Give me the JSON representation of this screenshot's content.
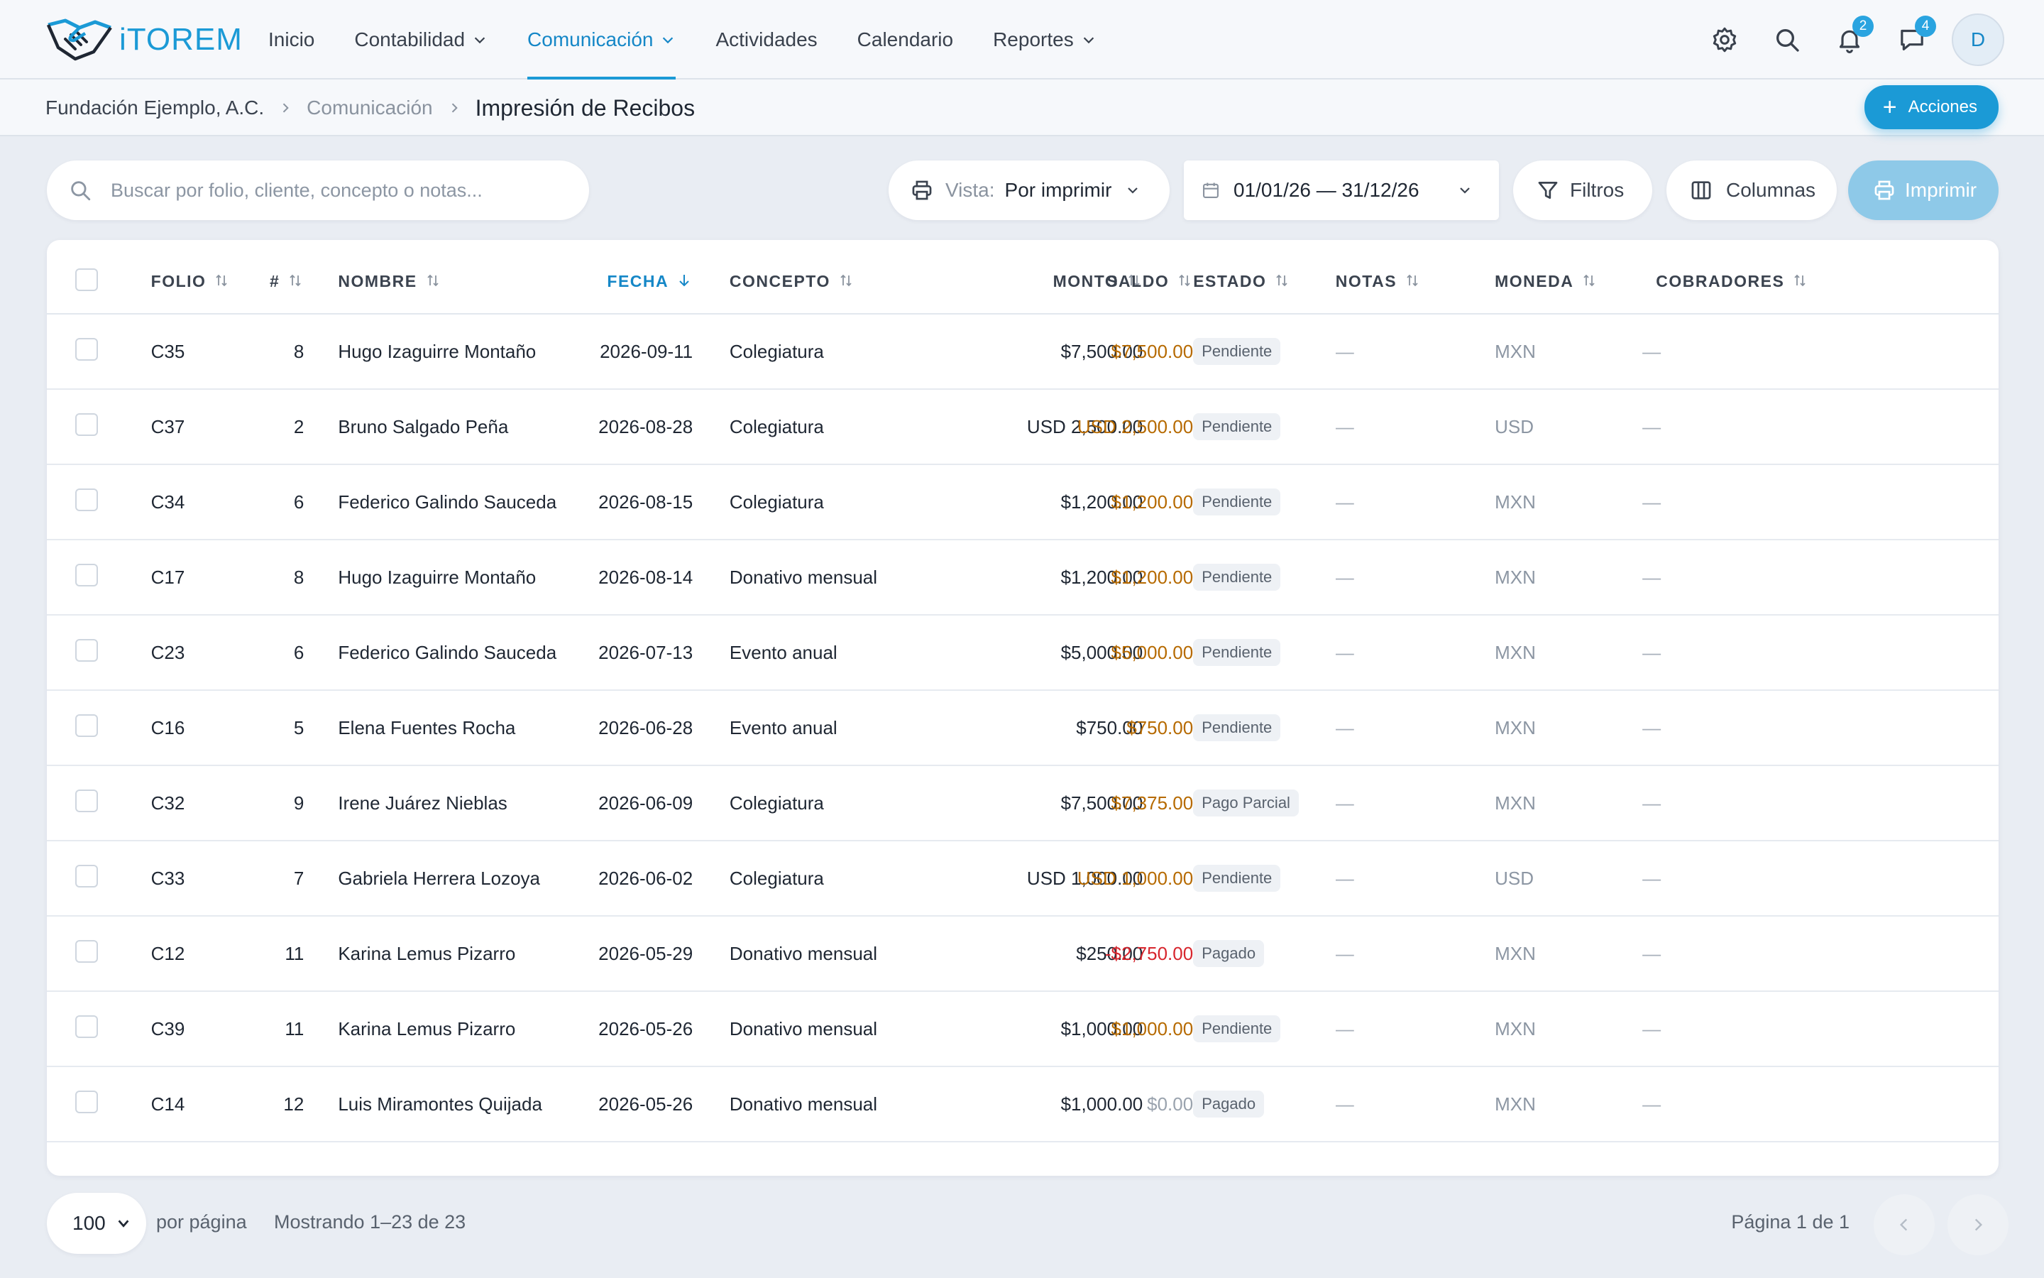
{
  "app": {
    "name": "iTOREM",
    "user_initial": "D"
  },
  "nav": {
    "items": [
      {
        "label": "Inicio",
        "dropdown": false,
        "active": false
      },
      {
        "label": "Contabilidad",
        "dropdown": true,
        "active": false
      },
      {
        "label": "Comunicación",
        "dropdown": true,
        "active": true
      },
      {
        "label": "Actividades",
        "dropdown": false,
        "active": false
      },
      {
        "label": "Calendario",
        "dropdown": false,
        "active": false
      },
      {
        "label": "Reportes",
        "dropdown": true,
        "active": false
      }
    ]
  },
  "header_icons": {
    "notifications_count": "2",
    "messages_count": "4"
  },
  "breadcrumb": {
    "org": "Fundación Ejemplo, A.C.",
    "section": "Comunicación",
    "current": "Impresión de Recibos"
  },
  "actions_button": "Acciones",
  "toolbar": {
    "search_placeholder": "Buscar por folio, cliente, concepto o notas...",
    "view_label": "Vista:",
    "view_value": "Por imprimir",
    "date_range": "01/01/26 — 31/12/26",
    "filters_label": "Filtros",
    "columns_label": "Columnas",
    "print_label": "Imprimir"
  },
  "table": {
    "columns": [
      "FOLIO",
      "#",
      "NOMBRE",
      "FECHA",
      "CONCEPTO",
      "MONTO",
      "SALDO",
      "ESTADO",
      "NOTAS",
      "MONEDA",
      "COBRADORES"
    ],
    "sorted_column": "FECHA",
    "rows": [
      {
        "folio": "C35",
        "num": "8",
        "nombre": "Hugo Izaguirre Montaño",
        "fecha": "2026-09-11",
        "concepto": "Colegiatura",
        "monto": "$7,500.00",
        "saldo": "$7,500.00",
        "saldo_type": "due",
        "estado": "Pendiente",
        "notas": "—",
        "moneda": "MXN",
        "cobradores": "—"
      },
      {
        "folio": "C37",
        "num": "2",
        "nombre": "Bruno Salgado Peña",
        "fecha": "2026-08-28",
        "concepto": "Colegiatura",
        "monto": "USD 2,500.00",
        "saldo": "USD 2,500.00",
        "saldo_type": "due",
        "estado": "Pendiente",
        "notas": "—",
        "moneda": "USD",
        "cobradores": "—"
      },
      {
        "folio": "C34",
        "num": "6",
        "nombre": "Federico Galindo Sauceda",
        "fecha": "2026-08-15",
        "concepto": "Colegiatura",
        "monto": "$1,200.00",
        "saldo": "$1,200.00",
        "saldo_type": "due",
        "estado": "Pendiente",
        "notas": "—",
        "moneda": "MXN",
        "cobradores": "—"
      },
      {
        "folio": "C17",
        "num": "8",
        "nombre": "Hugo Izaguirre Montaño",
        "fecha": "2026-08-14",
        "concepto": "Donativo mensual",
        "monto": "$1,200.00",
        "saldo": "$1,200.00",
        "saldo_type": "due",
        "estado": "Pendiente",
        "notas": "—",
        "moneda": "MXN",
        "cobradores": "—"
      },
      {
        "folio": "C23",
        "num": "6",
        "nombre": "Federico Galindo Sauceda",
        "fecha": "2026-07-13",
        "concepto": "Evento anual",
        "monto": "$5,000.00",
        "saldo": "$5,000.00",
        "saldo_type": "due",
        "estado": "Pendiente",
        "notas": "—",
        "moneda": "MXN",
        "cobradores": "—"
      },
      {
        "folio": "C16",
        "num": "5",
        "nombre": "Elena Fuentes Rocha",
        "fecha": "2026-06-28",
        "concepto": "Evento anual",
        "monto": "$750.00",
        "saldo": "$750.00",
        "saldo_type": "due",
        "estado": "Pendiente",
        "notas": "—",
        "moneda": "MXN",
        "cobradores": "—"
      },
      {
        "folio": "C32",
        "num": "9",
        "nombre": "Irene Juárez Nieblas",
        "fecha": "2026-06-09",
        "concepto": "Colegiatura",
        "monto": "$7,500.00",
        "saldo": "$7,375.00",
        "saldo_type": "due",
        "estado": "Pago Parcial",
        "notas": "—",
        "moneda": "MXN",
        "cobradores": "—"
      },
      {
        "folio": "C33",
        "num": "7",
        "nombre": "Gabriela Herrera Lozoya",
        "fecha": "2026-06-02",
        "concepto": "Colegiatura",
        "monto": "USD 1,000.00",
        "saldo": "USD 1,000.00",
        "saldo_type": "due",
        "estado": "Pendiente",
        "notas": "—",
        "moneda": "USD",
        "cobradores": "—"
      },
      {
        "folio": "C12",
        "num": "11",
        "nombre": "Karina Lemus Pizarro",
        "fecha": "2026-05-29",
        "concepto": "Donativo mensual",
        "monto": "$250.00",
        "saldo": "-$2,750.00",
        "saldo_type": "neg",
        "estado": "Pagado",
        "notas": "—",
        "moneda": "MXN",
        "cobradores": "—"
      },
      {
        "folio": "C39",
        "num": "11",
        "nombre": "Karina Lemus Pizarro",
        "fecha": "2026-05-26",
        "concepto": "Donativo mensual",
        "monto": "$1,000.00",
        "saldo": "$1,000.00",
        "saldo_type": "due",
        "estado": "Pendiente",
        "notas": "—",
        "moneda": "MXN",
        "cobradores": "—"
      },
      {
        "folio": "C14",
        "num": "12",
        "nombre": "Luis Miramontes Quijada",
        "fecha": "2026-05-26",
        "concepto": "Donativo mensual",
        "monto": "$1,000.00",
        "saldo": "$0.00",
        "saldo_type": "zero",
        "estado": "Pagado",
        "notas": "—",
        "moneda": "MXN",
        "cobradores": "—"
      }
    ]
  },
  "footer": {
    "per_page_value": "100",
    "per_page_label": "por página",
    "showing": "Mostrando 1–23 de 23",
    "page_info": "Página 1 de 1"
  }
}
